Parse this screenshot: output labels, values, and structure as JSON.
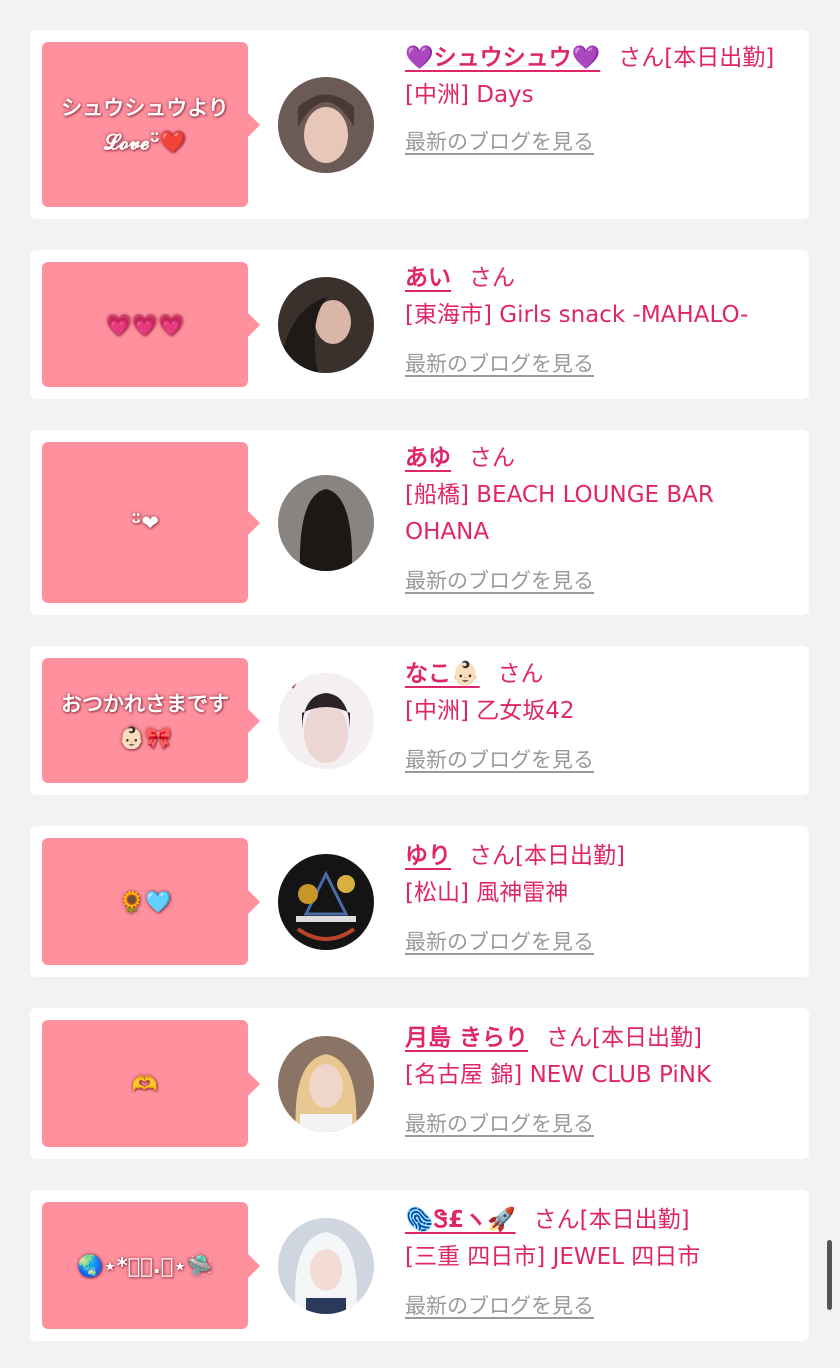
{
  "blog_label": "最新のブログを見る",
  "san": "さん",
  "entries": [
    {
      "message": [
        "シュウシュウより",
        "𝓛𝓸𝓿𝓮ᵕ̈❤️"
      ],
      "name": "💜シュウシュウ💜",
      "status": "[本日出勤]",
      "shop": "[中洲] Days",
      "avatar_color": "#6b5a55"
    },
    {
      "message": [
        "💗💗💗"
      ],
      "name": "あい",
      "status": "",
      "shop": "[東海市] Girls snack -MAHALO-",
      "avatar_color": "#3a302c"
    },
    {
      "message": [
        "ᵕ̈❤︎"
      ],
      "name": "あゆ",
      "status": "",
      "shop": "[船橋] BEACH LOUNGE BAR OHANA",
      "avatar_color": "#2a2624"
    },
    {
      "message": [
        "おつかれさまです",
        "👶🏻🎀"
      ],
      "name": "なこ👶🏻",
      "status": "",
      "shop": "[中洲] 乙女坂42",
      "avatar_color": "#f4f0f2"
    },
    {
      "message": [
        "🌻🩵"
      ],
      "name": "ゆり",
      "status": "[本日出勤]",
      "shop": "[松山] 風神雷神",
      "avatar_color": "#141414"
    },
    {
      "message": [
        "🫶"
      ],
      "name": "月島 きらり",
      "status": "[本日出勤]",
      "shop": "[名古屋 錦] NEW CLUB PiNK",
      "avatar_color": "#8a7466"
    },
    {
      "message": [
        "🌏⋆*ﾟ･.｡⋆🛸"
      ],
      "name": "🫆Ꮥ£ヽ🚀",
      "status": "[本日出勤]",
      "shop": "[三重 四日市] JEWEL 四日市",
      "avatar_color": "#cfd6e0"
    }
  ]
}
